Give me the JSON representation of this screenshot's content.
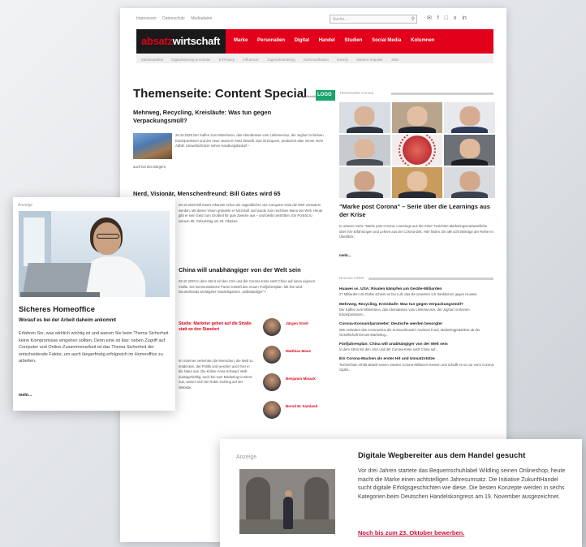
{
  "util_bar": {
    "links": [
      "Impressum",
      "Datenschutz",
      "Mediadaten"
    ],
    "search_placeholder": "Suche...",
    "search_icon": "search-icon",
    "social_icons": [
      "twitter-icon",
      "facebook-icon",
      "instagram-icon",
      "xing-icon",
      "linkedin-icon"
    ]
  },
  "nav": {
    "logo_part1": "absatz",
    "logo_part2": "wirtschaft",
    "items": [
      "Marke",
      "Personalien",
      "Digital",
      "Handel",
      "Studien",
      "Social Media",
      "Kolumnen"
    ],
    "subitems": [
      "Markenartikel",
      "Digitalisierung & Handel",
      "E-Privacy",
      "Influencer",
      "Jugendmarketing",
      "Kommunikation",
      "Events",
      "Marken-Impulse",
      "Jobs"
    ]
  },
  "page_title": {
    "title": "Themenseite: Content Special",
    "presented_by": "präsentiert von",
    "sponsor_logo": "LOGO"
  },
  "article1": {
    "title": "Mehrweg, Recycling, Kreisläufe: Was tun gegen Verpackungsmüll?",
    "body": "28.10.2020 Der Kaffee zum Mitnehmen, das Abendessen vom Lieferservice, der Joghurt in kleinen Einzelportionen und der neue Jeans im Netz bestellt. Das ist bequem, produziert aber immer mehr Abfall. Umweltschützer sehen Handlungsbedarf –",
    "tail": "auch bei den Bürgern."
  },
  "article2": {
    "title": "Nerd, Visionär, Menschenfreund: Bill Gates wird 65",
    "body": "28.10.2020 Bill Gates erkannte schon als Jugendlicher, wie Computer einst die Welt verändern werden. Mit dieser Vision gründete er Microsoft und wurde zum reichsten Mann der Welt. Heute gibt er sein Geld zum Großteil für gute Zwecke aus – und bleibt umstritten. Ein Porträt zu seinem 65. Geburtstag am 28. Oktober."
  },
  "article3": {
    "title": "China will unabhängiger von der Welt sein",
    "body": "28.10.2020 In dem Streit mit den USA und der Corona-Krise setzt China auf einen eigenen Kräfte. Die kommunistische Partei entwirft den neuen Fünfjahresplan. Mit ihm wird Deutschlands wichtigster Handelspartner „selbständiger“?"
  },
  "article4": {
    "link": "Studie: Marketer gehen auf die Straße statt an den Standort",
    "body": "Im Sommer verlernten die Menschen, die Welt zu entdecken, der Politik und weichen auch hier in die Natur aus. Die Kölner Anna Schwarz stellt aussagekräftig, auch bei zum Marketing-Content nun, warum sich bei Robin Gehling auf der Website."
  },
  "authors": [
    {
      "name": "Jürgen Streit"
    },
    {
      "name": "Matthias Maue"
    },
    {
      "name": "Benjamin Minack"
    },
    {
      "name": "Bernd M. Samland"
    }
  ],
  "sidebar": {
    "label": "Themenseite Corona",
    "feature_title": "\"Marke post Corona\" – Serie über die Learnings aus der Krise",
    "feature_body": "In unserer Serie \"Marke post Corona: Learnings aus der Krise\" berichten Marketingverantwortliche über ihre Erfahrungen und Lehren aus der Corona-Zeit. Hier finden Sie alle acht Beiträge der Reihe im Überblick.",
    "more": "mehr..."
  },
  "news": {
    "label": "Neueste Artikel",
    "items": [
      {
        "title": "Huawei vs. USA: Rivalen kämpfen um Geräte-Milliarden",
        "text": "27 Milliarden US-Dollar scheint es bei Luft, das die neuesten US Sanktionen gegen Huawei."
      },
      {
        "title": "Mehrweg, Recycling, Kreisläufe: Was tun gegen Verpackungsmüll?",
        "text": "Der Kaffee zum Mitnehmen, das Abendessen vom Lieferservice, der Joghurt in kleinen Einzelportionen..."
      },
      {
        "title": "Corona-Konsumbarometer: Deutsche werden besorgter",
        "text": "Wie verändert das Coronavirus die Konsumfreude? Andreas Fund, Marketingpräsident ab der Gesellschaft Emnes Marketing..."
      },
      {
        "title": "Fünfjahresplan: China will unabhängiger von der Welt sein",
        "text": "In dem Streit mit den USA und der Corona-Krise setzt China auf..."
      },
      {
        "title": "Ein Corona-Machen als erster Hit und Umsatzstütze",
        "text": "Tischenhain erhält aktuell seinen zweiten Corona-Millionen-Gewinn und schafft es so nur vorm Corona-Gipfel..."
      }
    ]
  },
  "ad_left": {
    "label": "Anzeige",
    "title": "Sicheres Homeoffice",
    "subtitle": "Worauf es bei der Arbeit daheim ankommt",
    "body": "Erfahren Sie, was wirklich wichtig ist und warum Sie beim Thema Sicherheit keine Kompromisse eingehen sollten. Denn eine ist klar: neben Zugriff auf Computer und Online-Zusammenarbeit ist das Thema Sicherheit der entscheidende Faktor, um auch längerfristig erfolgreich im Homeoffice zu arbeiten.",
    "more": "mehr..."
  },
  "ad_right": {
    "label": "Anzeige",
    "title": "Digitale Wegbereiter aus dem Handel gesucht",
    "body": "Vor drei Jahren startete das Bequemschuhlabel Wildling seinen Onlineshop, heute macht die Marke einen achtstelligen Jahresumsatz. Die Initiative ZukunftHandel sucht digitale Erfolgsgeschichten wie diese. Die besten Konzepte werden in sechs Kategorien beim Deutschen Handelskongress am 19. November ausgezeichnet.",
    "link": "Noch bis zum 23. Oktober bewerben."
  },
  "colors": {
    "brand_red": "#e2001a",
    "ad_link": "#c8103e",
    "sponsor_green": "#1aa36b"
  }
}
